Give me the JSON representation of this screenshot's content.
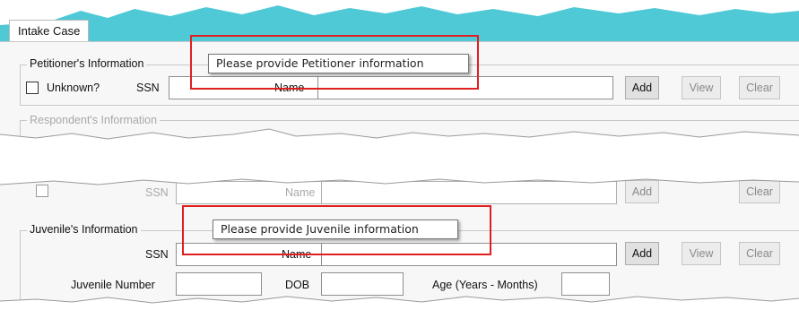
{
  "tab": {
    "label": "Intake Case"
  },
  "petitioner": {
    "legend": "Petitioner's Information",
    "unknown_label": "Unknown?",
    "ssn_label": "SSN",
    "name_label": "Name",
    "tooltip": "Please provide Petitioner information",
    "add_label": "Add",
    "view_label": "View",
    "clear_label": "Clear"
  },
  "respondent": {
    "legend": "Respondent's Information",
    "ssn_label": "SSN",
    "name_label": "Name",
    "add_label": "Add",
    "clear_label": "Clear"
  },
  "juvenile": {
    "legend": "Juvenile's Information",
    "ssn_label": "SSN",
    "name_label": "Name",
    "tooltip": "Please provide Juvenile information",
    "add_label": "Add",
    "view_label": "View",
    "clear_label": "Clear",
    "number_label": "Juvenile Number",
    "dob_label": "DOB",
    "age_label": "Age (Years - Months)"
  },
  "colors": {
    "tab_strip": "#4fc9d6",
    "highlight": "#e02020",
    "tooltip_border": "#767676"
  },
  "icons": {
    "unknown_checkbox": "checkbox-unchecked-icon"
  }
}
